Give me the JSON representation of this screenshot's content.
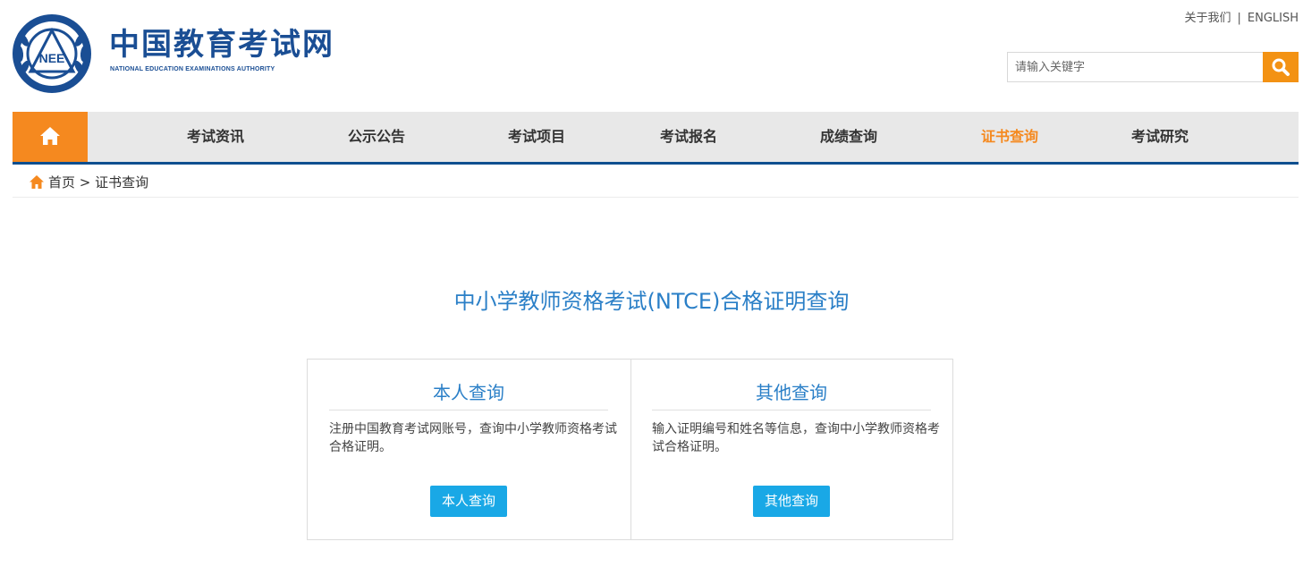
{
  "header": {
    "logo_cn": "中国教育考试网",
    "logo_en": "NATIONAL EDUCATION EXAMINATIONS AUTHORITY",
    "emblem_text": "NEE",
    "top_links": {
      "about": "关于我们",
      "separator": "|",
      "english": "ENGLISH"
    },
    "search": {
      "placeholder": "请输入关键字",
      "value": ""
    }
  },
  "nav": {
    "items": [
      {
        "label": "考试资讯"
      },
      {
        "label": "公示公告"
      },
      {
        "label": "考试项目"
      },
      {
        "label": "考试报名"
      },
      {
        "label": "成绩查询"
      },
      {
        "label": "证书查询"
      },
      {
        "label": "考试研究"
      }
    ],
    "active_label": "证书查询"
  },
  "breadcrumb": {
    "home": "首页",
    "separator": ">",
    "current": "证书查询"
  },
  "main": {
    "title": "中小学教师资格考试(NTCE)合格证明查询",
    "cards": [
      {
        "title": "本人查询",
        "description": "注册中国教育考试网账号，查询中小学教师资格考试合格证明。",
        "button": "本人查询"
      },
      {
        "title": "其他查询",
        "description": "输入证明编号和姓名等信息，查询中小学教师资格考试合格证明。",
        "button": "其他查询"
      }
    ]
  },
  "colors": {
    "brand_blue": "#1a4e94",
    "nav_accent": "#f5891f",
    "search_button": "#f39213",
    "title_blue": "#2a7fc7",
    "button_blue": "#19a8e6",
    "nav_rule": "#0e4f8f"
  },
  "icons": {
    "home": "home-icon",
    "search": "search-icon",
    "emblem": "neea-emblem-icon"
  }
}
